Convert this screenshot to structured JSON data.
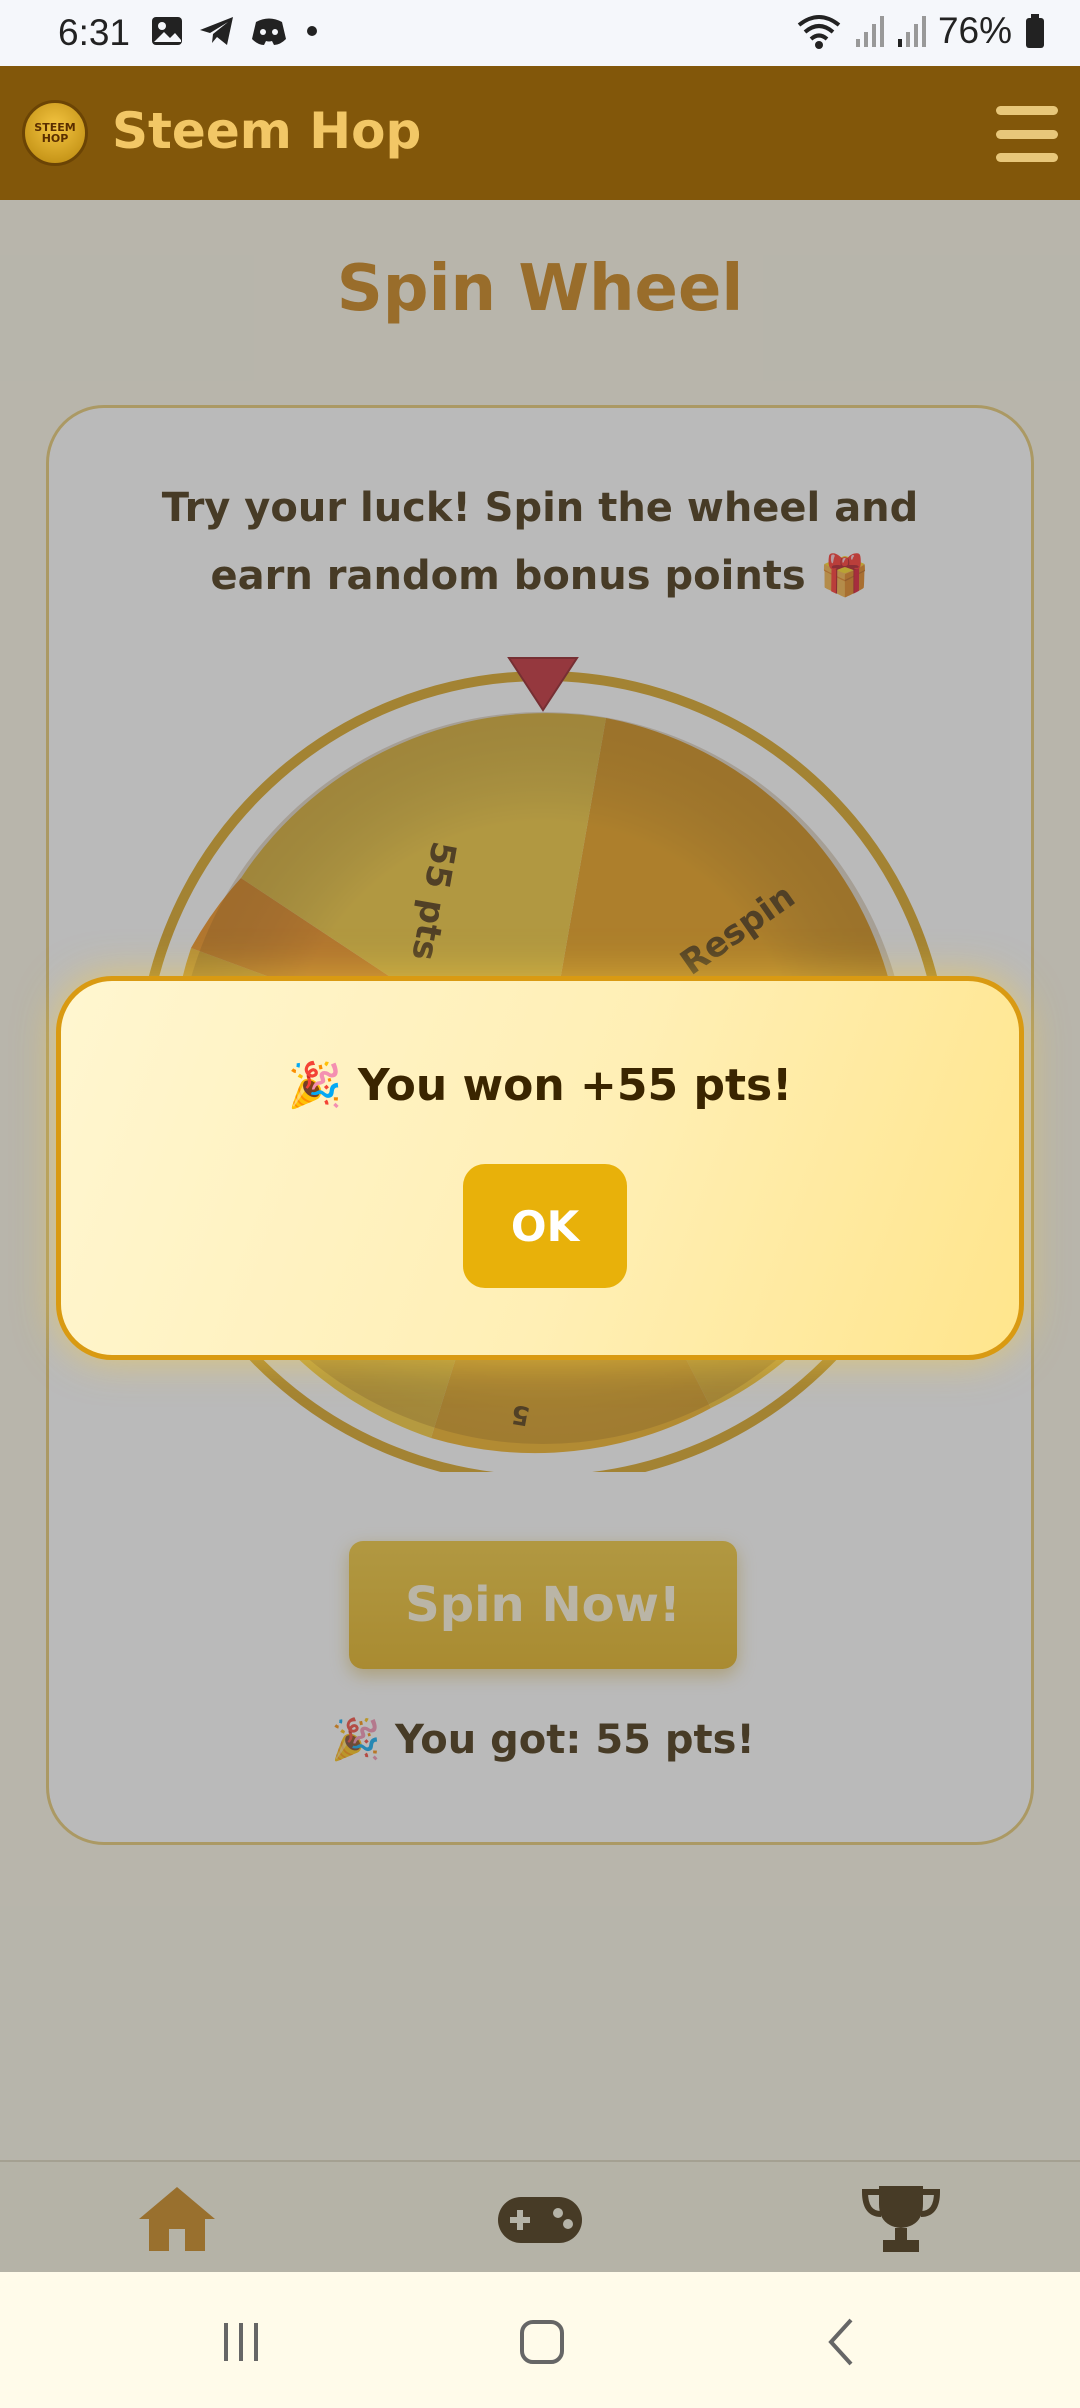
{
  "status_bar": {
    "time": "6:31",
    "battery": "76%",
    "icons": [
      "gallery-icon",
      "telegram-icon",
      "discord-icon",
      "dot-icon",
      "wifi-icon",
      "signal-icon",
      "signal-icon",
      "battery-icon"
    ]
  },
  "header": {
    "logo_text": "STEEM HOP",
    "title": "Steem Hop",
    "menu_icon": "hamburger-menu-icon"
  },
  "page": {
    "title": "Spin Wheel",
    "description": "Try your luck! Spin the wheel and earn random bonus points 🎁"
  },
  "wheel": {
    "segment_labels": [
      "55 pts",
      "Respin",
      "5"
    ],
    "pointer_color": "#C0202A",
    "rim_color": "#D8A017"
  },
  "spin_button": {
    "label": "Spin Now!"
  },
  "result": {
    "text": "🎉 You got: 55 pts!"
  },
  "modal": {
    "message": "🎉 You won +55 pts!",
    "ok_label": "OK"
  },
  "bottom_nav": {
    "items": [
      {
        "icon": "home-icon"
      },
      {
        "icon": "gamepad-icon"
      },
      {
        "icon": "trophy-icon"
      }
    ]
  },
  "system_nav": {
    "items": [
      "recent-apps-icon",
      "home-button-icon",
      "back-icon"
    ]
  },
  "colors": {
    "header_bg": "#82570A",
    "accent": "#E8B10A",
    "title_color": "#C77A0A"
  }
}
